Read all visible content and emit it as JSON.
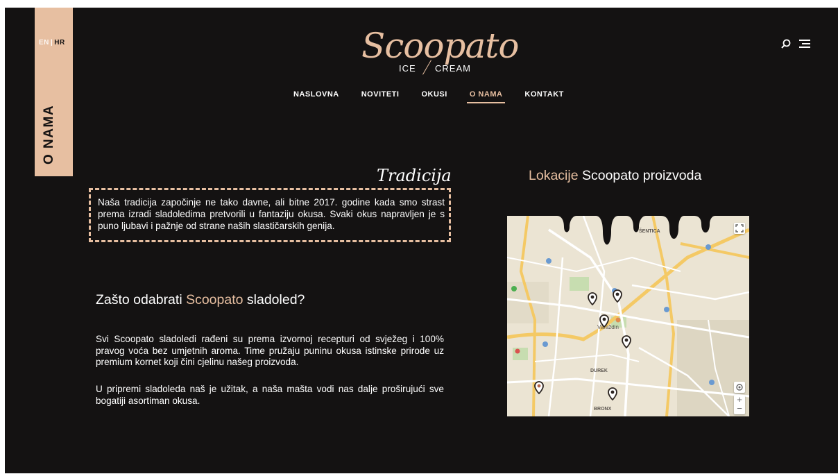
{
  "side": {
    "lang_en": "EN",
    "lang_sep": "|",
    "lang_hr": "HR",
    "title": "O NAMA"
  },
  "logo": {
    "script": "Scoopato",
    "sub_left": "ICE",
    "sub_right": "CREAM"
  },
  "nav": [
    {
      "label": "NASLOVNA",
      "active": false
    },
    {
      "label": "NOVITETI",
      "active": false
    },
    {
      "label": "OKUSI",
      "active": false
    },
    {
      "label": "O NAMA",
      "active": true
    },
    {
      "label": "KONTAKT",
      "active": false
    }
  ],
  "tradicija": {
    "script_title": "Tradicija",
    "text": "Naša tradicija započinje ne tako davne, ali bitne 2017. godine kada smo strast prema izradi sladoledima pretvorili u fantaziju okusa. Svaki okus napravljen je s puno ljubavi i pažnje od strane naših slastičarskih genija."
  },
  "why": {
    "heading_prefix": "Zašto odabrati ",
    "heading_accent": "Scoopato",
    "heading_suffix": " sladoled?",
    "p1": "Svi Scoopato sladoledi rađeni su prema izvornoj recepturi od svježeg i 100% pravog voća bez umjetnih aroma. Time pružaju puninu okusa istinske prirode uz premium kornet koji čini cjelinu našeg proizvoda.",
    "p2": "U pripremi sladoleda naš je užitak, a naša mašta vodi nas dalje proširujući sve bogatiji asortiman okusa."
  },
  "locations": {
    "heading_accent": "Lokacije",
    "heading_rest": " Scoopato proizvoda",
    "map_labels": {
      "city": "Varaždin",
      "district1": "DUREK",
      "district2": "BRONX",
      "top": "ŠENTICA"
    },
    "zoom_in": "+",
    "zoom_out": "−"
  },
  "colors": {
    "background": "#141212",
    "accent": "#e7bfa1",
    "text": "#ffffff"
  },
  "icons": [
    "search-icon",
    "menu-icon",
    "map-pin-icon",
    "fullscreen-icon",
    "locate-icon"
  ]
}
